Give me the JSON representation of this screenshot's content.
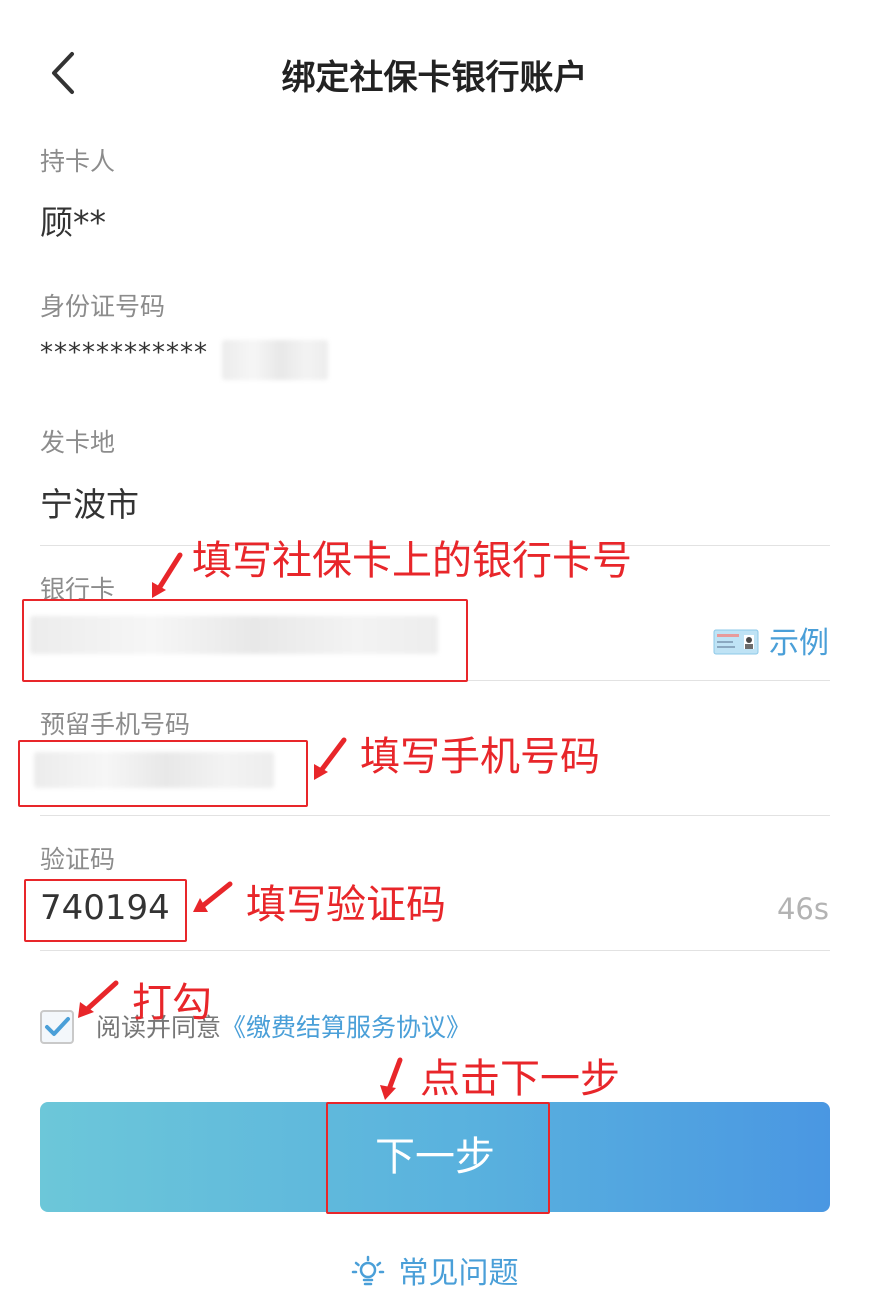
{
  "header": {
    "title": "绑定社保卡银行账户"
  },
  "fields": {
    "holder": {
      "label": "持卡人",
      "value": "顾**"
    },
    "id_number": {
      "label": "身份证号码",
      "value": "************"
    },
    "region": {
      "label": "发卡地",
      "value": "宁波市"
    },
    "bank_card": {
      "label": "银行卡",
      "example": "示例"
    },
    "phone": {
      "label": "预留手机号码"
    },
    "verify_code": {
      "label": "验证码",
      "value": "740194",
      "countdown": "46s"
    }
  },
  "agreement": {
    "prefix": "阅读并同意",
    "link": "《缴费结算服务协议》",
    "checked": true
  },
  "buttons": {
    "next": "下一步"
  },
  "faq": {
    "label": "常见问题"
  },
  "annotations": {
    "bank_card": "填写社保卡上的银行卡号",
    "phone": "填写手机号码",
    "verify_code": "填写验证码",
    "check": "打勾",
    "next": "点击下一步"
  },
  "colors": {
    "accent": "#4a9fd8",
    "annotation": "#e8262a",
    "button_start": "#6cc7d9",
    "button_end": "#4a97e2"
  }
}
